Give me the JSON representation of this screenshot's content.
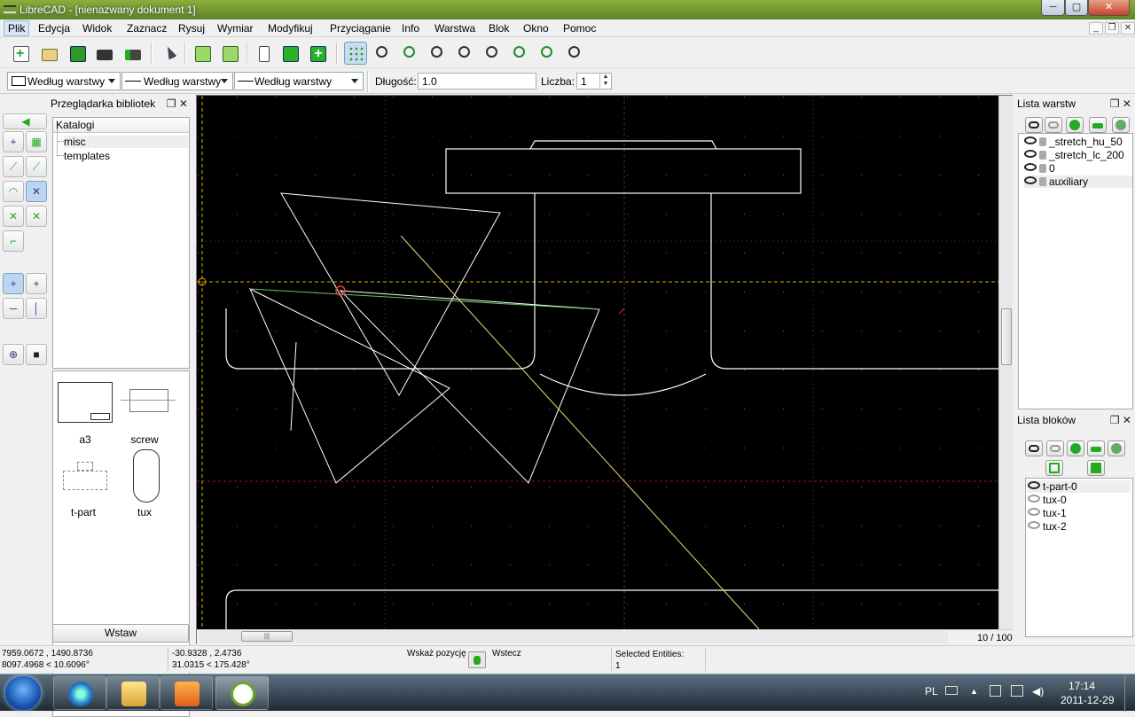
{
  "window": {
    "title": "LibreCAD - [nienazwany dokument 1]",
    "min_label": "─",
    "max_label": "▢",
    "close_label": "✕"
  },
  "menu": {
    "items": [
      "Plik",
      "Edycja",
      "Widok",
      "Zaznacz",
      "Rysuj",
      "Wymiar",
      "Modyfikuj",
      "Przyciąganie",
      "Info",
      "Warstwa",
      "Blok",
      "Okno",
      "Pomoc"
    ],
    "mdi": {
      "min": "_",
      "restore": "❐",
      "close": "✕"
    }
  },
  "toolbar_main": {
    "icons": [
      "new-icon",
      "open-icon",
      "save-icon",
      "print-icon",
      "print-preview-icon",
      "select-pointer-icon",
      "undo-icon",
      "redo-icon",
      "cut-icon",
      "copy-icon",
      "paste-icon",
      "grid-icon",
      "zoom-redraw-icon",
      "zoom-window-icon",
      "zoom-in-icon",
      "zoom-out-icon",
      "zoom-auto-icon",
      "zoom-previous-icon",
      "zoom-selection-icon",
      "zoom-pan-icon"
    ],
    "accent": "#2aa52a"
  },
  "toolbar_pen": {
    "color_combo": "Według warstwy",
    "width_combo": "Według warstwy",
    "type_combo": "Według warstwy",
    "length_label": "Długość:",
    "length_value": "1.0",
    "count_label": "Liczba:",
    "count_value": "1"
  },
  "library": {
    "title": "Przeglądarka bibliotek",
    "dock_buttons": "❐ ✕",
    "tree_header": "Katalogi",
    "tree_items": [
      "misc",
      "templates"
    ],
    "thumbnails": [
      "a3",
      "screw",
      "t-part",
      "tux"
    ],
    "insert_button": "Wstaw"
  },
  "layers": {
    "title": "Lista warstw",
    "dock_buttons": "❐ ✕",
    "items": [
      "_stretch_hu_50",
      "_stretch_lc_200",
      "0",
      "auxiliary"
    ]
  },
  "blocks": {
    "title": "Lista bloków",
    "dock_buttons": "❐ ✕",
    "items": [
      "t-part-0",
      "tux-0",
      "tux-1",
      "tux-2"
    ]
  },
  "canvas": {
    "page_count": "10 / 100",
    "background": "#000000",
    "entity_color": "#ffffff",
    "guide_color": "#e0b000",
    "grid_color": "#8a1a1a"
  },
  "status": {
    "abs_coords": "7959.0672 , 1490.8736",
    "abs_polar": "8097.4968 < 10.6096°",
    "rel_coords": "-30.9328 , 2.4736",
    "rel_polar": "31.0315 < 175.428°",
    "prompt": "Wskaż pozycję",
    "back": "Wstecz",
    "selected_label": "Selected Entities:",
    "selected_count": "1"
  },
  "taskbar": {
    "lang": "PL",
    "time": "17:14",
    "date": "2011-12-29"
  }
}
